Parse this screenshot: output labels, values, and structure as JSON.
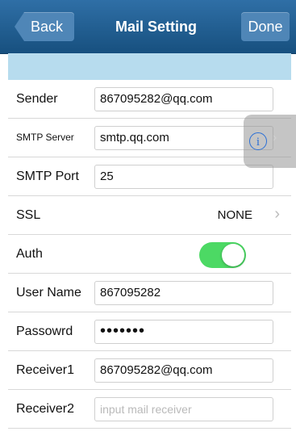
{
  "navbar": {
    "back_label": "Back",
    "title": "Mail Setting",
    "done_label": "Done"
  },
  "rows": {
    "sender": {
      "label": "Sender",
      "value": "867095282@qq.com"
    },
    "smtp_server": {
      "label": "SMTP Server",
      "value": "smtp.qq.com"
    },
    "smtp_port": {
      "label": "SMTP Port",
      "value": "25"
    },
    "ssl": {
      "label": "SSL",
      "value": "NONE"
    },
    "auth": {
      "label": "Auth",
      "enabled": true
    },
    "user_name": {
      "label": "User Name",
      "value": "867095282"
    },
    "password": {
      "label": "Passowrd",
      "value": "•••••••"
    },
    "receiver1": {
      "label": "Receiver1",
      "value": "867095282@qq.com"
    },
    "receiver2": {
      "label": "Receiver2",
      "value": "",
      "placeholder": "input mail receiver"
    }
  },
  "icons": {
    "info": "info-icon",
    "chevron": "chevron-right-icon"
  },
  "colors": {
    "navbar": "#1f5e93",
    "toggle_on": "#4cd964",
    "band": "#b7dcee"
  }
}
